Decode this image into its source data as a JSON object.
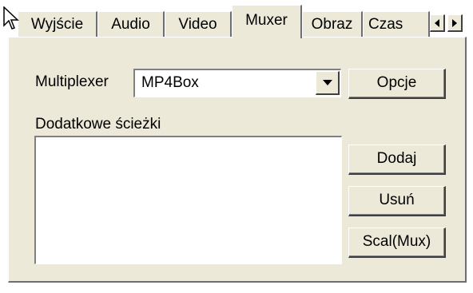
{
  "tabs": [
    {
      "label": "Wyjście",
      "active": false
    },
    {
      "label": "Audio",
      "active": false
    },
    {
      "label": "Video",
      "active": false
    },
    {
      "label": "Muxer",
      "active": true
    },
    {
      "label": "Obraz",
      "active": false
    },
    {
      "label": "Czas",
      "active": false
    }
  ],
  "tab_scroll": {
    "left_icon": "arrow-left-icon",
    "right_icon": "arrow-right-icon"
  },
  "muxer": {
    "multiplexer_label": "Multiplexer",
    "multiplexer_value": "MP4Box",
    "options_button": "Opcje",
    "tracks_label": "Dodatkowe ścieżki",
    "tracks_items": [],
    "add_button": "Dodaj",
    "remove_button": "Usuń",
    "merge_button": "Scal(Mux)"
  },
  "colors": {
    "face": "#ece9d8",
    "shadow": "#404040",
    "highlight": "#ffffff"
  }
}
